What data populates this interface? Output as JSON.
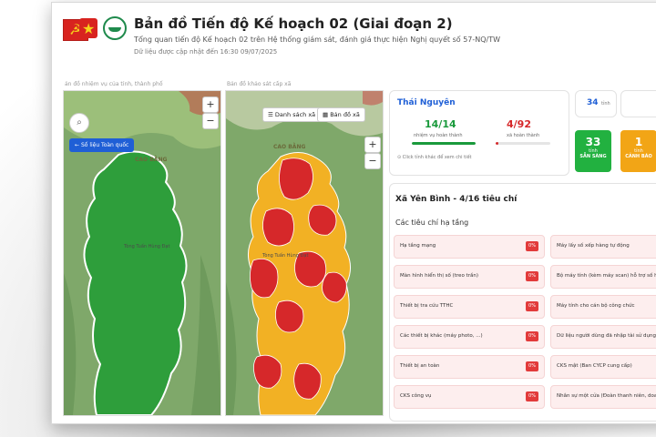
{
  "header": {
    "title": "Bản đồ Tiến độ Kế hoạch 02 (Giai đoạn 2)",
    "subtitle": "Tổng quan tiến độ Kế hoạch 02 trên Hệ thống giám sát, đánh giá thực hiện Nghị quyết số 57-NQ/TW",
    "updated": "Dữ liệu được cập nhật đến 16:30 09/07/2025"
  },
  "map_left": {
    "label": "ản đồ nhiệm vụ của tỉnh, thành phố",
    "back_button": "Số liệu Toàn quốc",
    "place_name": "CAO BẰNG",
    "place_text": "Tòng Tuấn Hùng Đạt",
    "zoom_in": "+",
    "zoom_out": "−",
    "fill_color": "#2e9e3b"
  },
  "map_right": {
    "label": "Bản đồ khảo sát cấp xã",
    "tab_list": "Danh sách xã",
    "tab_map": "Bản đồ xã",
    "place_name": "CAO BẰNG",
    "place_text": "Tòng Tuấn Hùng Đạt",
    "zoom_in": "+",
    "zoom_out": "−",
    "red": "#d6282a",
    "yellow": "#f2b124"
  },
  "province": {
    "name": "Thái Nguyên",
    "tasks_done": "14/14",
    "tasks_label": "nhiệm vụ hoàn thành",
    "tasks_progress": 1.0,
    "communes_done": "4/92",
    "communes_label": "xã hoàn thành",
    "communes_progress": 0.043,
    "hint": "Click tỉnh khác để xem chi tiết",
    "green": "#1a9a3c",
    "red": "#d6282a"
  },
  "summary": {
    "province_count": "34",
    "province_unit": "tỉnh"
  },
  "statuses": [
    {
      "num": "33",
      "l1": "tỉnh",
      "l2": "SẴN SÀNG",
      "color": "#22b140"
    },
    {
      "num": "1",
      "l1": "tỉnh",
      "l2": "CẢNH BÁO",
      "color": "#f2a516"
    }
  ],
  "commune": {
    "title": "Xã Yên Bình - 4/16 tiêu chí",
    "section": "Các tiêu chí hạ tầng",
    "criteria_left": [
      {
        "label": "Hạ tầng mạng",
        "pct": "0%"
      },
      {
        "label": "Màn hình hiển thị số (treo trần)",
        "pct": "0%"
      },
      {
        "label": "Thiết bị tra cứu TTHC",
        "pct": "0%"
      },
      {
        "label": "Các thiết bị khác (máy photo, ...)",
        "pct": "0%"
      },
      {
        "label": "Thiết bị an toàn",
        "pct": "0%"
      },
      {
        "label": "CKS công vụ",
        "pct": "0%"
      }
    ],
    "criteria_right": [
      {
        "label": "Máy lấy số xếp hàng tự động"
      },
      {
        "label": "Bộ máy tính (kèm máy scan) hỗ trợ số hóa giấy tờ"
      },
      {
        "label": "Máy tính cho cán bộ công chức"
      },
      {
        "label": "Dữ liệu người dùng đã nhập tài sử dụng được"
      },
      {
        "label": "CKS mật (Ban CYCP cung cấp)"
      },
      {
        "label": "Nhân sự một cửa (Đoàn thanh niên, doanh nghiệp)"
      }
    ]
  }
}
